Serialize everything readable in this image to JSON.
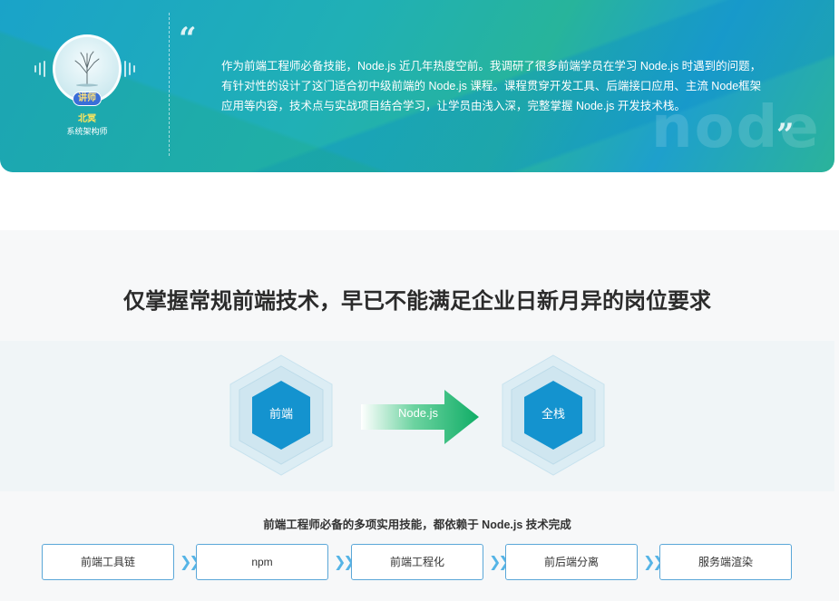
{
  "banner": {
    "badge": "讲师",
    "teacher_name": "北冥",
    "teacher_title": "系统架构师",
    "quote_open": "“",
    "quote_close": "”",
    "intro": "作为前端工程师必备技能，Node.js 近几年热度空前。我调研了很多前端学员在学习 Node.js 时遇到的问题，有针对性的设计了这门适合初中级前端的 Node.js 课程。课程贯穿开发工具、后端接口应用、主流 Node框架应用等内容，技术点与实战项目结合学习，让学员由浅入深，完整掌握 Node.js 开发技术栈。",
    "watermark": "node"
  },
  "section": {
    "title": "仅掌握常规前端技术，早已不能满足企业日新月异的岗位要求",
    "diagram": {
      "left_label": "前端",
      "arrow_label": "Node.js",
      "right_label": "全栈"
    },
    "skills_caption": "前端工程师必备的多项实用技能，都依赖于 Node.js 技术完成",
    "skills": [
      "前端工具链",
      "npm",
      "前端工程化",
      "前后端分离",
      "服务端渲染"
    ]
  },
  "colors": {
    "hex_core": "#1493cf",
    "arrow_start": "#ffffff",
    "arrow_end": "#10ad66",
    "box_border": "#5aa7d8",
    "chevron": "#55b4e6",
    "teacher_name": "#ffe65c"
  },
  "icons": [
    "tree-avatar-image",
    "sound-wave-icon",
    "quote-open-icon",
    "quote-close-icon",
    "double-chevron-right-icon"
  ]
}
